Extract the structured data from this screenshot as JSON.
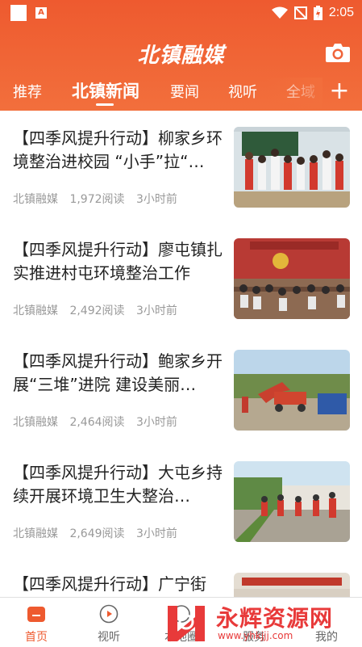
{
  "status_bar": {
    "time": "2:05"
  },
  "header": {
    "app_title": "北镇融媒"
  },
  "tabs": [
    {
      "label": "推荐"
    },
    {
      "label": "北镇新闻"
    },
    {
      "label": "要闻"
    },
    {
      "label": "视听"
    },
    {
      "label": "全域"
    }
  ],
  "add_channel_label": "+",
  "articles": [
    {
      "title": "【四季风提升行动】柳家乡环境整治进校园 “小手”拉“…",
      "source": "北镇融媒",
      "reads": "1,972阅读",
      "time": "3小时前"
    },
    {
      "title": "【四季风提升行动】廖屯镇扎实推进村屯环境整治工作",
      "source": "北镇融媒",
      "reads": "2,492阅读",
      "time": "3小时前"
    },
    {
      "title": "【四季风提升行动】鲍家乡开展“三堆”进院 建设美丽…",
      "source": "北镇融媒",
      "reads": "2,464阅读",
      "time": "3小时前"
    },
    {
      "title": "【四季风提升行动】大屯乡持续开展环境卫生大整治…",
      "source": "北镇融媒",
      "reads": "2,649阅读",
      "time": "3小时前"
    },
    {
      "title": "【四季风提升行动】广宁街",
      "source": "",
      "reads": "",
      "time": ""
    }
  ],
  "bottom_nav": [
    {
      "label": "首页"
    },
    {
      "label": "视听"
    },
    {
      "label": "本地圈"
    },
    {
      "label": "服务"
    },
    {
      "label": "我的"
    }
  ],
  "watermark": {
    "title": "永辉资源网",
    "url": "www.yhkjjj.com"
  },
  "colors": {
    "primary": "#ee5a2f",
    "text": "#222222",
    "meta": "#999999"
  }
}
